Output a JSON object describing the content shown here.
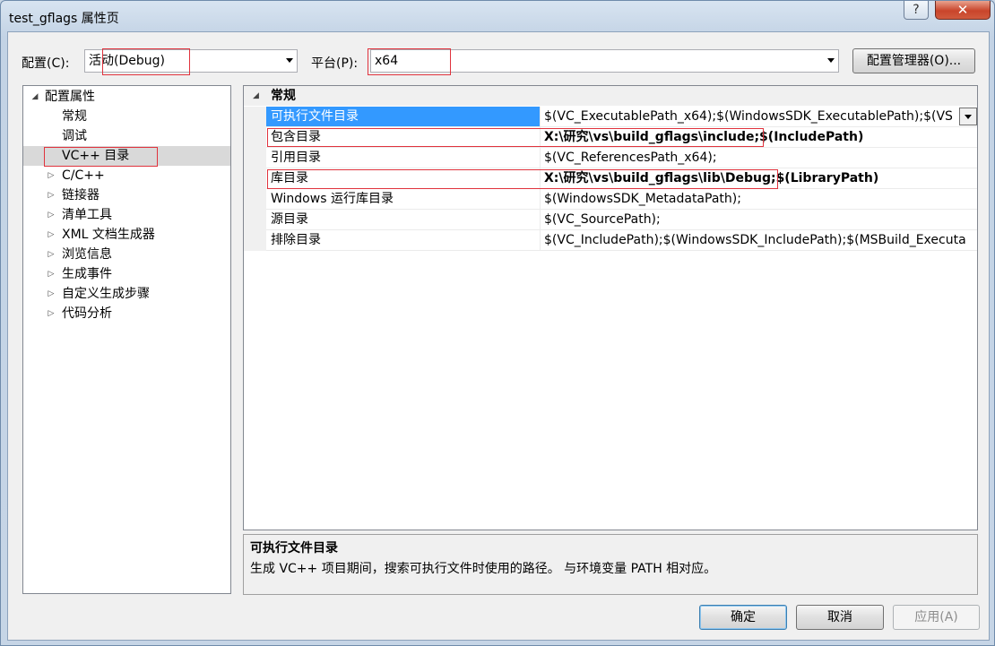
{
  "window": {
    "title": "test_gflags 属性页",
    "help_label": "?",
    "close_label": "✕"
  },
  "config": {
    "label": "配置(C):",
    "value": "活动(Debug)",
    "platform_label": "平台(P):",
    "platform_value": "x64",
    "manager_button": "配置管理器(O)..."
  },
  "tree": {
    "items": [
      {
        "label": "配置属性",
        "twisty": "◢"
      },
      {
        "label": "常规",
        "twisty": ""
      },
      {
        "label": "调试",
        "twisty": ""
      },
      {
        "label": "VC++ 目录",
        "twisty": ""
      },
      {
        "label": "C/C++",
        "twisty": "▷"
      },
      {
        "label": "链接器",
        "twisty": "▷"
      },
      {
        "label": "清单工具",
        "twisty": "▷"
      },
      {
        "label": "XML 文档生成器",
        "twisty": "▷"
      },
      {
        "label": "浏览信息",
        "twisty": "▷"
      },
      {
        "label": "生成事件",
        "twisty": "▷"
      },
      {
        "label": "自定义生成步骤",
        "twisty": "▷"
      },
      {
        "label": "代码分析",
        "twisty": "▷"
      }
    ]
  },
  "grid": {
    "category": "常规",
    "category_twisty": "◢",
    "rows": [
      {
        "name": "可执行文件目录",
        "value": "$(VC_ExecutablePath_x64);$(WindowsSDK_ExecutablePath);$(VS"
      },
      {
        "name": "包含目录",
        "value": "X:\\研究\\vs\\build_gflags\\include;$(IncludePath)"
      },
      {
        "name": "引用目录",
        "value": "$(VC_ReferencesPath_x64);"
      },
      {
        "name": "库目录",
        "value": "X:\\研究\\vs\\build_gflags\\lib\\Debug;$(LibraryPath)"
      },
      {
        "name": "Windows 运行库目录",
        "value": "$(WindowsSDK_MetadataPath);"
      },
      {
        "name": "源目录",
        "value": "$(VC_SourcePath);"
      },
      {
        "name": "排除目录",
        "value": "$(VC_IncludePath);$(WindowsSDK_IncludePath);$(MSBuild_Executa"
      }
    ]
  },
  "description": {
    "title": "可执行文件目录",
    "text": "生成 VC++ 项目期间，搜索可执行文件时使用的路径。 与环境变量 PATH 相对应。"
  },
  "buttons": {
    "ok": "确定",
    "cancel": "取消",
    "apply": "应用(A)"
  }
}
